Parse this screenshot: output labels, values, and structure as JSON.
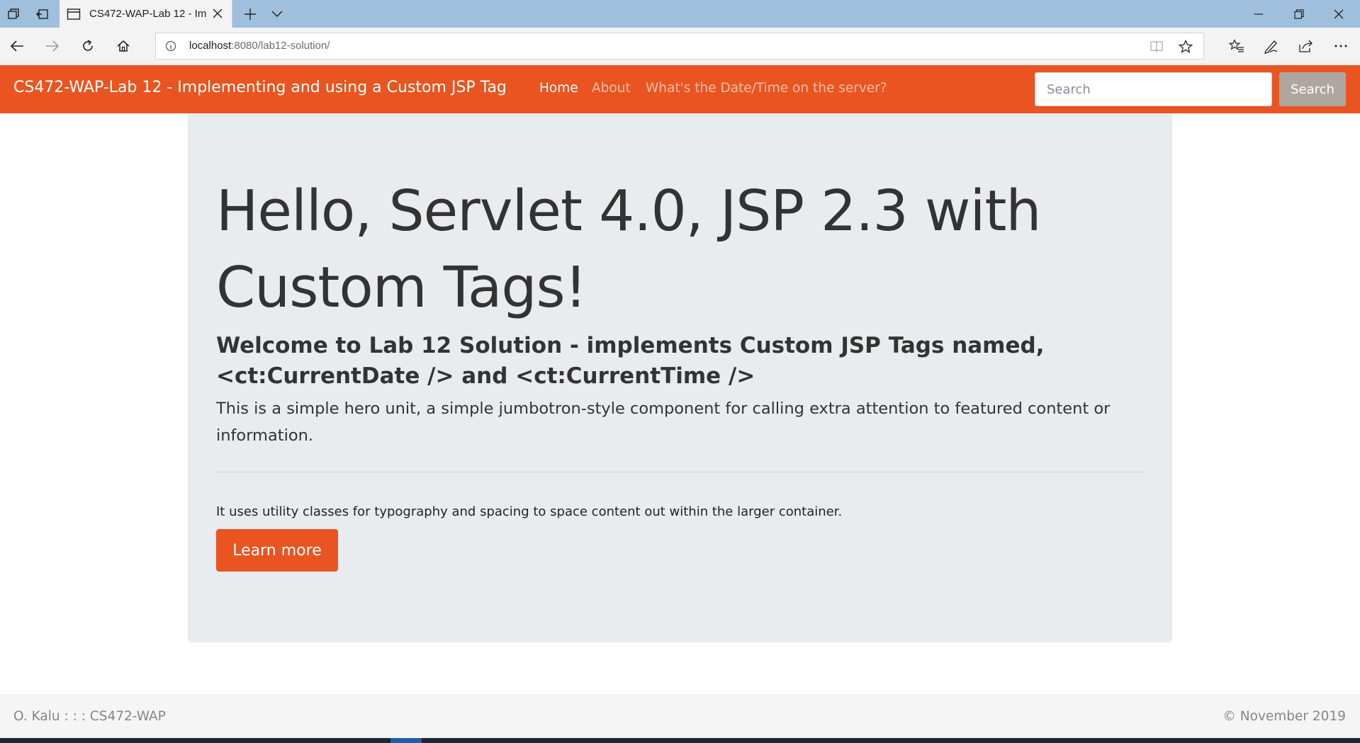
{
  "browser": {
    "tab_title": "CS472-WAP-Lab 12 - Im",
    "url_host": "localhost",
    "url_rest": ":8080/lab12-solution/"
  },
  "navbar": {
    "brand": "CS472-WAP-Lab 12 - Implementing and using a Custom JSP Tag",
    "links": [
      {
        "label": "Home",
        "active": true
      },
      {
        "label": "About",
        "active": false
      },
      {
        "label": "What's the Date/Time on the server?",
        "active": false
      }
    ],
    "search_placeholder": "Search",
    "search_button": "Search"
  },
  "jumbotron": {
    "display": "Hello, Servlet 4.0, JSP 2.3 with Custom Tags!",
    "heading": "Welcome to Lab 12 Solution - implements Custom JSP Tags named, <ct:CurrentDate /> and <ct:CurrentTime />",
    "lead": "This is a simple hero unit, a simple jumbotron-style component for calling extra attention to featured content or information.",
    "body": "It uses utility classes for typography and spacing to space content out within the larger container.",
    "button": "Learn more"
  },
  "footer": {
    "left": "O. Kalu : : : CS472-WAP",
    "right": "© November 2019"
  },
  "colors": {
    "primary": "#e95420",
    "secondary": "#aea79f",
    "jumbotron_bg": "#e9ecef",
    "browser_tabbar": "#9fbfdc"
  }
}
